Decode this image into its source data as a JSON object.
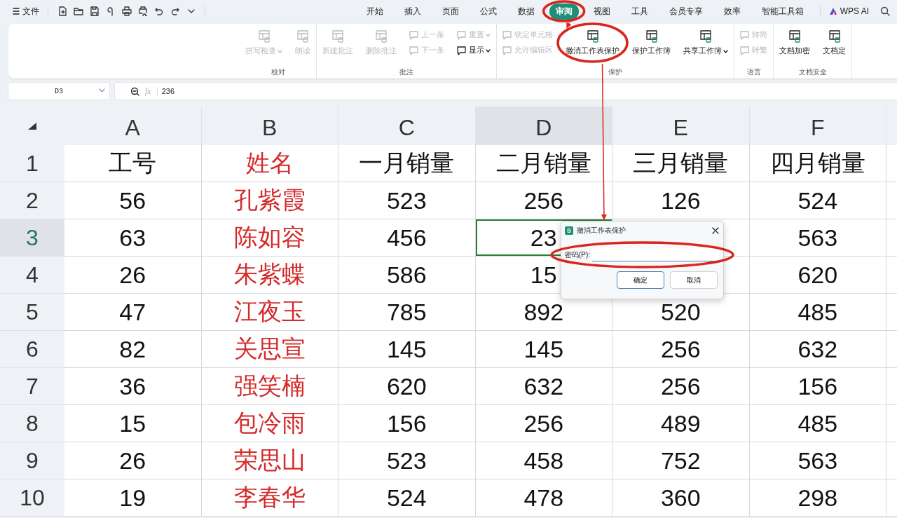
{
  "toolbar": {
    "file_menu": "文件"
  },
  "tabs": [
    {
      "label": "开始",
      "selected": false
    },
    {
      "label": "插入",
      "selected": false
    },
    {
      "label": "页面",
      "selected": false
    },
    {
      "label": "公式",
      "selected": false
    },
    {
      "label": "数据",
      "selected": false
    },
    {
      "label": "审阅",
      "selected": true
    },
    {
      "label": "视图",
      "selected": false
    },
    {
      "label": "工具",
      "selected": false
    },
    {
      "label": "会员专享",
      "selected": false
    },
    {
      "label": "效率",
      "selected": false
    },
    {
      "label": "智能工具箱",
      "selected": false
    }
  ],
  "ai_button": "WPS AI",
  "ribbon": {
    "groups": [
      {
        "label": "校对",
        "items": [
          {
            "kind": "large",
            "label": "拼写检查",
            "disabled": true,
            "dropdown": true
          },
          {
            "kind": "large",
            "label": "朗读",
            "disabled": true,
            "dropdown": false
          }
        ]
      },
      {
        "label": "批注",
        "items": [
          {
            "kind": "large",
            "label": "新建批注",
            "disabled": true,
            "dropdown": false
          },
          {
            "kind": "large",
            "label": "删除批注",
            "disabled": true,
            "dropdown": false
          },
          {
            "kind": "small",
            "label": "上一条",
            "disabled": true,
            "dropdown": false
          },
          {
            "kind": "small",
            "label": "下一条",
            "disabled": true,
            "dropdown": false
          },
          {
            "kind": "small",
            "label": "重置",
            "disabled": true,
            "dropdown": true
          },
          {
            "kind": "small",
            "label": "显示",
            "disabled": false,
            "dropdown": true
          }
        ]
      },
      {
        "label": "保护",
        "items": [
          {
            "kind": "small",
            "label": "锁定单元格",
            "disabled": true,
            "dropdown": false
          },
          {
            "kind": "small",
            "label": "允许编辑区",
            "disabled": true,
            "dropdown": false
          },
          {
            "kind": "large",
            "label": "撤消工作表保护",
            "disabled": false,
            "dropdown": false
          },
          {
            "kind": "large",
            "label": "保护工作簿",
            "disabled": false,
            "dropdown": false
          },
          {
            "kind": "large",
            "label": "共享工作簿",
            "disabled": false,
            "dropdown": true
          }
        ]
      },
      {
        "label": "语言",
        "items": [
          {
            "kind": "small",
            "label": "转简",
            "disabled": true,
            "dropdown": false
          },
          {
            "kind": "small",
            "label": "转繁",
            "disabled": true,
            "dropdown": false
          }
        ]
      },
      {
        "label": "文档安全",
        "items": [
          {
            "kind": "large",
            "label": "文档加密",
            "disabled": false,
            "dropdown": false
          },
          {
            "kind": "large",
            "label": "文档定",
            "disabled": false,
            "dropdown": false
          }
        ]
      }
    ]
  },
  "formula_bar": {
    "cell_ref": "D3",
    "fx_label": "fx",
    "value": "236"
  },
  "table": {
    "columns": [
      {
        "label": "A",
        "selected": false
      },
      {
        "label": "B",
        "selected": false,
        "color": "#d42a2a"
      },
      {
        "label": "C",
        "selected": false
      },
      {
        "label": "D",
        "selected": true
      },
      {
        "label": "E",
        "selected": false
      },
      {
        "label": "F",
        "selected": false
      }
    ],
    "rows": [
      {
        "header": "1",
        "selected": false,
        "cells": [
          "工号",
          "姓名",
          "一月销量",
          "二月销量",
          "三月销量",
          "四月销量"
        ]
      },
      {
        "header": "2",
        "selected": false,
        "cells": [
          "56",
          "孔紫霞",
          "523",
          "256",
          "126",
          "524"
        ]
      },
      {
        "header": "3",
        "selected": true,
        "cells": [
          "63",
          "陈如容",
          "456",
          "23",
          "",
          "563"
        ]
      },
      {
        "header": "4",
        "selected": false,
        "cells": [
          "26",
          "朱紫蝶",
          "586",
          "15",
          "",
          "620"
        ]
      },
      {
        "header": "5",
        "selected": false,
        "cells": [
          "47",
          "江夜玉",
          "785",
          "892",
          "520",
          "485"
        ]
      },
      {
        "header": "6",
        "selected": false,
        "cells": [
          "82",
          "关思宣",
          "145",
          "145",
          "256",
          "632"
        ]
      },
      {
        "header": "7",
        "selected": false,
        "cells": [
          "36",
          "强笑楠",
          "620",
          "632",
          "256",
          "156"
        ]
      },
      {
        "header": "8",
        "selected": false,
        "cells": [
          "15",
          "包冷雨",
          "156",
          "256",
          "489",
          "485"
        ]
      },
      {
        "header": "9",
        "selected": false,
        "cells": [
          "26",
          "荣思山",
          "523",
          "458",
          "752",
          "563"
        ]
      },
      {
        "header": "10",
        "selected": false,
        "cells": [
          "19",
          "李春华",
          "524",
          "478",
          "360",
          "298"
        ]
      }
    ]
  },
  "dialog": {
    "app_badge": "S",
    "title": "撤消工作表保护",
    "field_label": "密码(P):",
    "buttons": [
      {
        "label": "确定",
        "kind": "primary"
      },
      {
        "label": "取消",
        "kind": "secondary"
      }
    ]
  }
}
